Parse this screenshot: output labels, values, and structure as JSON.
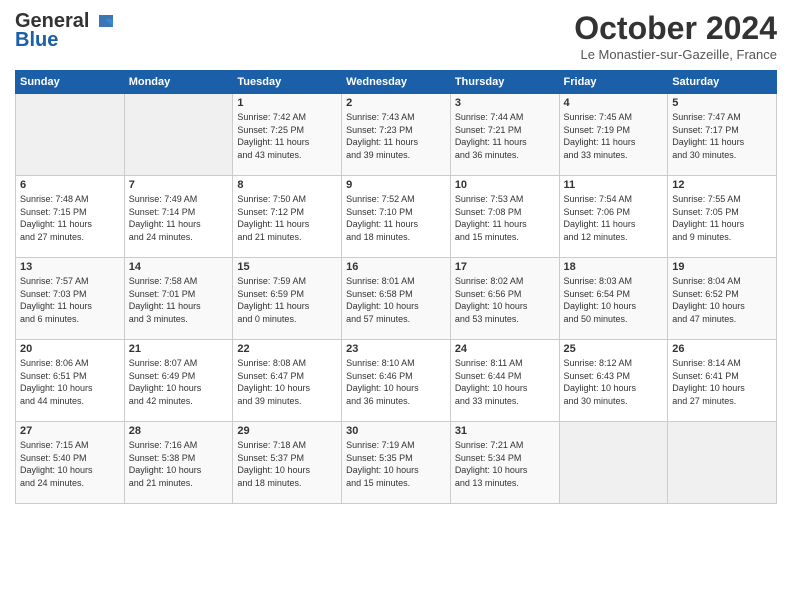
{
  "header": {
    "logo_line1": "General",
    "logo_line2": "Blue",
    "month": "October 2024",
    "location": "Le Monastier-sur-Gazeille, France"
  },
  "days_of_week": [
    "Sunday",
    "Monday",
    "Tuesday",
    "Wednesday",
    "Thursday",
    "Friday",
    "Saturday"
  ],
  "weeks": [
    [
      {
        "day": "",
        "info": ""
      },
      {
        "day": "",
        "info": ""
      },
      {
        "day": "1",
        "info": "Sunrise: 7:42 AM\nSunset: 7:25 PM\nDaylight: 11 hours\nand 43 minutes."
      },
      {
        "day": "2",
        "info": "Sunrise: 7:43 AM\nSunset: 7:23 PM\nDaylight: 11 hours\nand 39 minutes."
      },
      {
        "day": "3",
        "info": "Sunrise: 7:44 AM\nSunset: 7:21 PM\nDaylight: 11 hours\nand 36 minutes."
      },
      {
        "day": "4",
        "info": "Sunrise: 7:45 AM\nSunset: 7:19 PM\nDaylight: 11 hours\nand 33 minutes."
      },
      {
        "day": "5",
        "info": "Sunrise: 7:47 AM\nSunset: 7:17 PM\nDaylight: 11 hours\nand 30 minutes."
      }
    ],
    [
      {
        "day": "6",
        "info": "Sunrise: 7:48 AM\nSunset: 7:15 PM\nDaylight: 11 hours\nand 27 minutes."
      },
      {
        "day": "7",
        "info": "Sunrise: 7:49 AM\nSunset: 7:14 PM\nDaylight: 11 hours\nand 24 minutes."
      },
      {
        "day": "8",
        "info": "Sunrise: 7:50 AM\nSunset: 7:12 PM\nDaylight: 11 hours\nand 21 minutes."
      },
      {
        "day": "9",
        "info": "Sunrise: 7:52 AM\nSunset: 7:10 PM\nDaylight: 11 hours\nand 18 minutes."
      },
      {
        "day": "10",
        "info": "Sunrise: 7:53 AM\nSunset: 7:08 PM\nDaylight: 11 hours\nand 15 minutes."
      },
      {
        "day": "11",
        "info": "Sunrise: 7:54 AM\nSunset: 7:06 PM\nDaylight: 11 hours\nand 12 minutes."
      },
      {
        "day": "12",
        "info": "Sunrise: 7:55 AM\nSunset: 7:05 PM\nDaylight: 11 hours\nand 9 minutes."
      }
    ],
    [
      {
        "day": "13",
        "info": "Sunrise: 7:57 AM\nSunset: 7:03 PM\nDaylight: 11 hours\nand 6 minutes."
      },
      {
        "day": "14",
        "info": "Sunrise: 7:58 AM\nSunset: 7:01 PM\nDaylight: 11 hours\nand 3 minutes."
      },
      {
        "day": "15",
        "info": "Sunrise: 7:59 AM\nSunset: 6:59 PM\nDaylight: 11 hours\nand 0 minutes."
      },
      {
        "day": "16",
        "info": "Sunrise: 8:01 AM\nSunset: 6:58 PM\nDaylight: 10 hours\nand 57 minutes."
      },
      {
        "day": "17",
        "info": "Sunrise: 8:02 AM\nSunset: 6:56 PM\nDaylight: 10 hours\nand 53 minutes."
      },
      {
        "day": "18",
        "info": "Sunrise: 8:03 AM\nSunset: 6:54 PM\nDaylight: 10 hours\nand 50 minutes."
      },
      {
        "day": "19",
        "info": "Sunrise: 8:04 AM\nSunset: 6:52 PM\nDaylight: 10 hours\nand 47 minutes."
      }
    ],
    [
      {
        "day": "20",
        "info": "Sunrise: 8:06 AM\nSunset: 6:51 PM\nDaylight: 10 hours\nand 44 minutes."
      },
      {
        "day": "21",
        "info": "Sunrise: 8:07 AM\nSunset: 6:49 PM\nDaylight: 10 hours\nand 42 minutes."
      },
      {
        "day": "22",
        "info": "Sunrise: 8:08 AM\nSunset: 6:47 PM\nDaylight: 10 hours\nand 39 minutes."
      },
      {
        "day": "23",
        "info": "Sunrise: 8:10 AM\nSunset: 6:46 PM\nDaylight: 10 hours\nand 36 minutes."
      },
      {
        "day": "24",
        "info": "Sunrise: 8:11 AM\nSunset: 6:44 PM\nDaylight: 10 hours\nand 33 minutes."
      },
      {
        "day": "25",
        "info": "Sunrise: 8:12 AM\nSunset: 6:43 PM\nDaylight: 10 hours\nand 30 minutes."
      },
      {
        "day": "26",
        "info": "Sunrise: 8:14 AM\nSunset: 6:41 PM\nDaylight: 10 hours\nand 27 minutes."
      }
    ],
    [
      {
        "day": "27",
        "info": "Sunrise: 7:15 AM\nSunset: 5:40 PM\nDaylight: 10 hours\nand 24 minutes."
      },
      {
        "day": "28",
        "info": "Sunrise: 7:16 AM\nSunset: 5:38 PM\nDaylight: 10 hours\nand 21 minutes."
      },
      {
        "day": "29",
        "info": "Sunrise: 7:18 AM\nSunset: 5:37 PM\nDaylight: 10 hours\nand 18 minutes."
      },
      {
        "day": "30",
        "info": "Sunrise: 7:19 AM\nSunset: 5:35 PM\nDaylight: 10 hours\nand 15 minutes."
      },
      {
        "day": "31",
        "info": "Sunrise: 7:21 AM\nSunset: 5:34 PM\nDaylight: 10 hours\nand 13 minutes."
      },
      {
        "day": "",
        "info": ""
      },
      {
        "day": "",
        "info": ""
      }
    ]
  ]
}
